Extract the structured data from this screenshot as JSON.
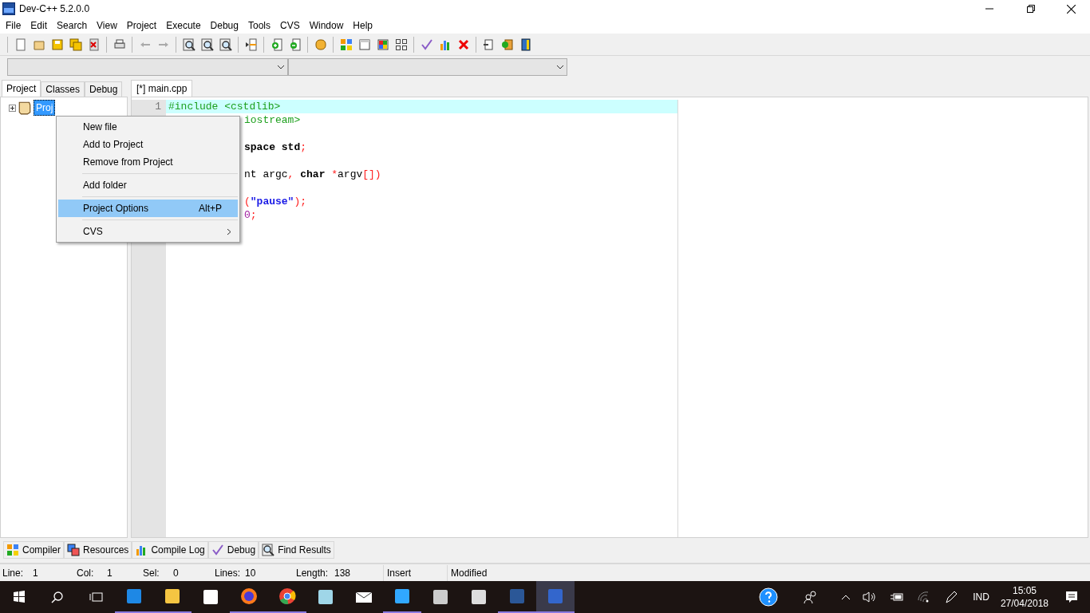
{
  "window": {
    "title": "Dev-C++ 5.2.0.0"
  },
  "menu_bar": [
    "File",
    "Edit",
    "Search",
    "View",
    "Project",
    "Execute",
    "Debug",
    "Tools",
    "CVS",
    "Window",
    "Help"
  ],
  "left_tabs": [
    {
      "label": "Project",
      "selected": true
    },
    {
      "label": "Classes",
      "selected": false
    },
    {
      "label": "Debug",
      "selected": false
    }
  ],
  "project_tree": {
    "label": "Proj",
    "selected": true,
    "expanded": false
  },
  "editor_tabs": [
    {
      "label": "[*] main.cpp",
      "selected": true
    }
  ],
  "gutter": {
    "line_numbers": [
      "1"
    ]
  },
  "code_lines": [
    {
      "kind": "full",
      "current": true,
      "segments": [
        {
          "text": "#include <cstdlib>",
          "kind": "preproc"
        }
      ]
    },
    {
      "kind": "partial",
      "current": false,
      "segments": [
        {
          "text": "iostream>",
          "kind": "preproc"
        }
      ]
    },
    {
      "kind": "empty",
      "current": false
    },
    {
      "kind": "partial",
      "current": false,
      "segments": [
        {
          "text": "space std",
          "kind": "keyword"
        },
        {
          "text": ";",
          "kind": "symbol"
        }
      ]
    },
    {
      "kind": "empty",
      "current": false
    },
    {
      "kind": "partial",
      "current": false,
      "segments": [
        {
          "text": "nt argc",
          "kind": "plain"
        },
        {
          "text": ",",
          "kind": "symbol"
        },
        {
          "text": " char",
          "kind": "keyword"
        },
        {
          "text": " *",
          "kind": "symbol"
        },
        {
          "text": "argv",
          "kind": "plain"
        },
        {
          "text": "[])",
          "kind": "symbol"
        }
      ]
    },
    {
      "kind": "empty",
      "current": false
    },
    {
      "kind": "partial",
      "current": false,
      "segments": [
        {
          "text": "(",
          "kind": "symbol"
        },
        {
          "text": "\"pause\"",
          "kind": "string"
        },
        {
          "text": ");",
          "kind": "symbol"
        }
      ]
    },
    {
      "kind": "partial",
      "current": false,
      "segments": [
        {
          "text": "0",
          "kind": "number"
        },
        {
          "text": ";",
          "kind": "symbol"
        }
      ]
    }
  ],
  "context_menu": [
    {
      "kind": "item",
      "label": "New file",
      "selected": false
    },
    {
      "kind": "item",
      "label": "Add to Project",
      "selected": false
    },
    {
      "kind": "item",
      "label": "Remove from Project",
      "selected": false
    },
    {
      "kind": "separator"
    },
    {
      "kind": "item",
      "label": "Add folder",
      "selected": false
    },
    {
      "kind": "separator"
    },
    {
      "kind": "item",
      "label": "Project Options",
      "shortcut": "Alt+P",
      "selected": true
    },
    {
      "kind": "separator"
    },
    {
      "kind": "submenu",
      "label": "CVS",
      "selected": false
    }
  ],
  "bottom_tabs": [
    {
      "label": "Compiler"
    },
    {
      "label": "Resources"
    },
    {
      "label": "Compile Log"
    },
    {
      "label": "Debug"
    },
    {
      "label": "Find Results"
    }
  ],
  "status_bar": [
    {
      "label": "Line:",
      "value": "1"
    },
    {
      "label": "Col:",
      "value": "1"
    },
    {
      "label": "Sel:",
      "value": "0"
    },
    {
      "label": "Lines:",
      "value": "10"
    },
    {
      "label": "Length:",
      "value": "138"
    }
  ],
  "status_mode": [
    "Insert",
    "Modified"
  ],
  "taskbar": {
    "language": "IND",
    "time": "15:05",
    "date": "27/04/2018"
  }
}
